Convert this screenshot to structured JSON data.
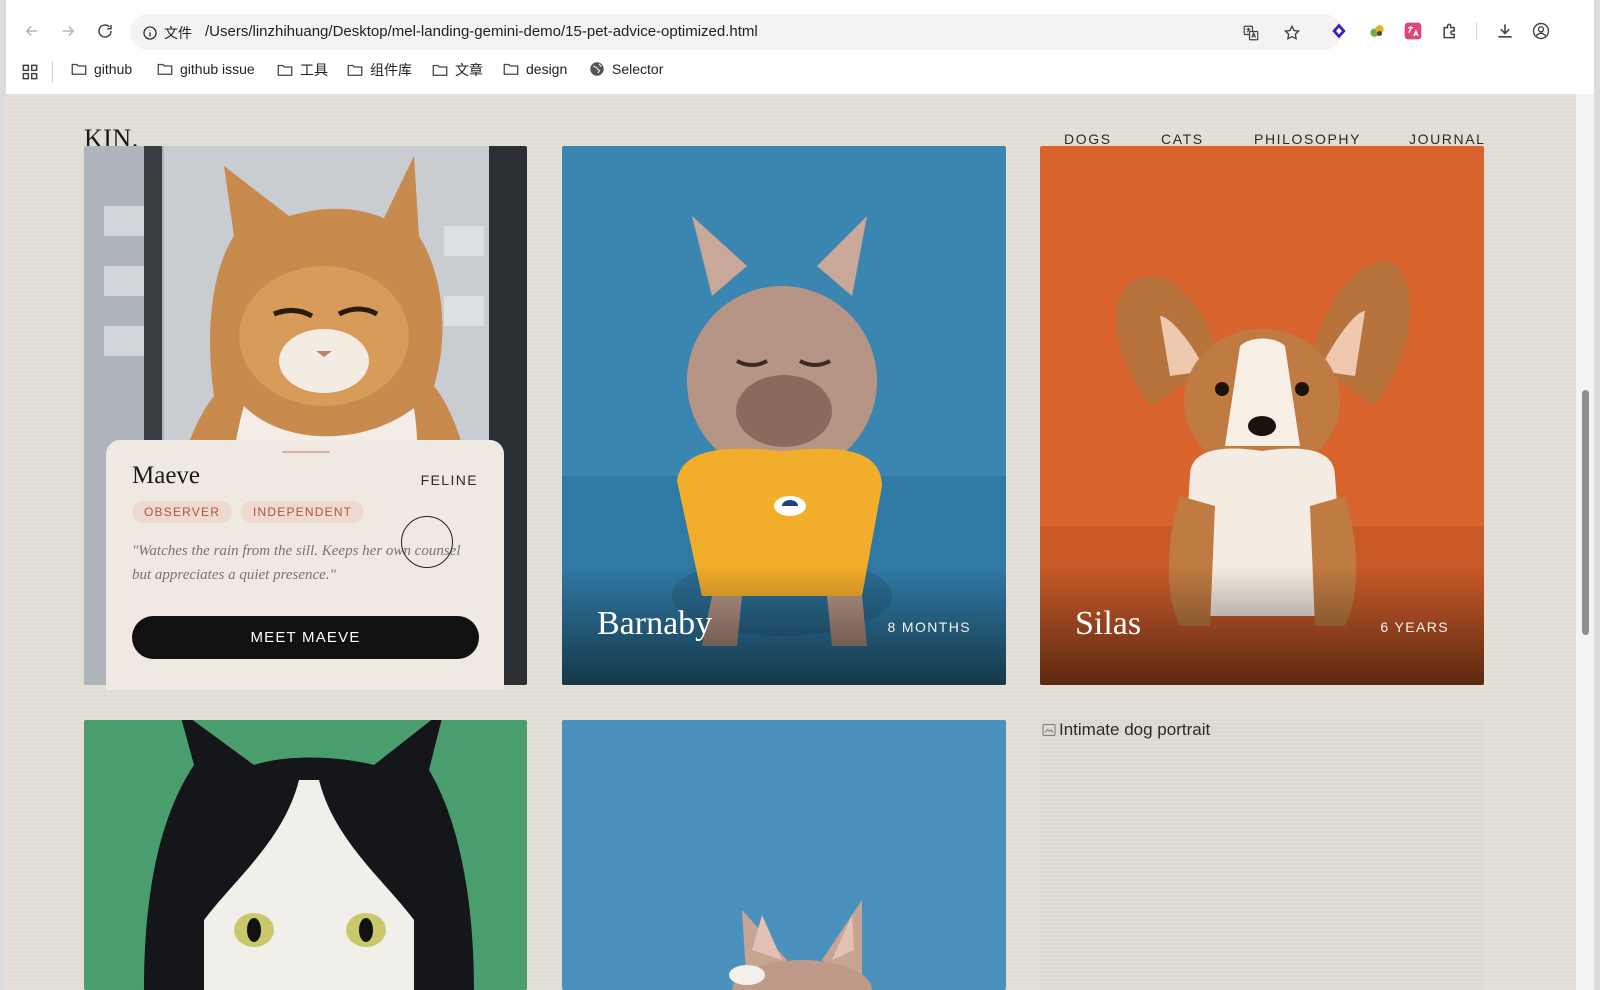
{
  "browser": {
    "security_label": "文件",
    "url": "/Users/linzhihuang/Desktop/mel-landing-gemini-demo/15-pet-advice-optimized.html"
  },
  "bookmarks": [
    {
      "label": "github",
      "icon": "folder-icon"
    },
    {
      "label": "github issue",
      "icon": "folder-icon"
    },
    {
      "label": "工具",
      "icon": "folder-icon"
    },
    {
      "label": "组件库",
      "icon": "folder-icon"
    },
    {
      "label": "文章",
      "icon": "folder-icon"
    },
    {
      "label": "design",
      "icon": "folder-icon"
    },
    {
      "label": "Selector",
      "icon": "globe-icon"
    }
  ],
  "site": {
    "logo": "KIN.",
    "nav": [
      "DOGS",
      "CATS",
      "PHILOSOPHY",
      "JOURNAL"
    ]
  },
  "featured": {
    "name": "Maeve",
    "kind": "FELINE",
    "tags": [
      "OBSERVER",
      "INDEPENDENT"
    ],
    "quote": "\"Watches the rain from the sill. Keeps her own counsel but appreciates a quiet presence.\"",
    "cta": "MEET MAEVE"
  },
  "cards": [
    {
      "name": "Barnaby",
      "age": "8 MONTHS",
      "bg": "#3a86b0"
    },
    {
      "name": "Silas",
      "age": "6 YEARS",
      "bg": "#d9642d"
    }
  ],
  "row2": {
    "cat_bg": "#4a9e6e",
    "dog_bg": "#4a92bd",
    "broken_alt": "Intimate dog portrait"
  },
  "colors": {
    "accent": "#b5533f",
    "page_bg": "#e4e0d8",
    "button": "#111111"
  }
}
